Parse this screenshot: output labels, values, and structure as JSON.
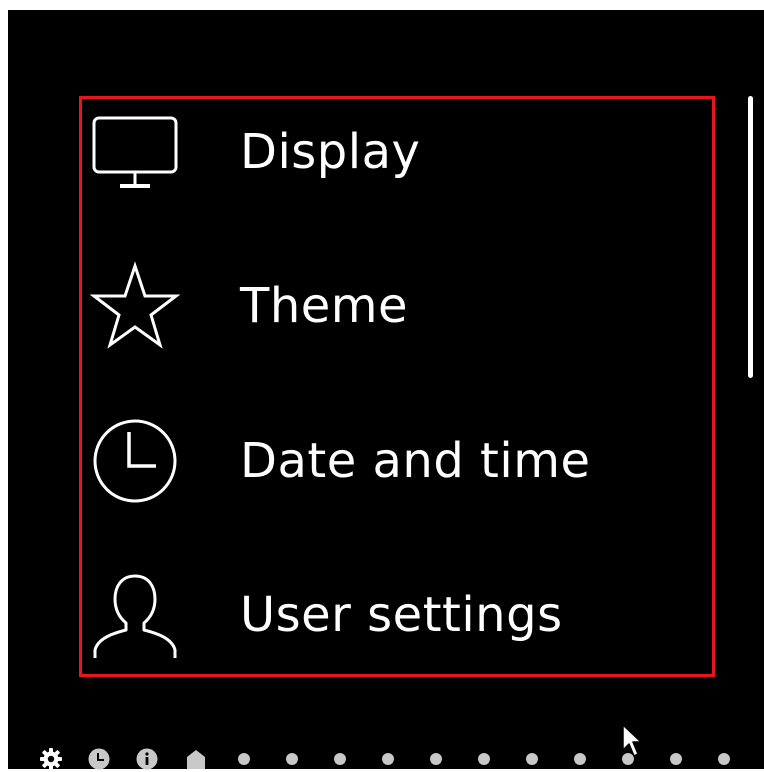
{
  "menu": {
    "items": [
      {
        "label": "Display",
        "icon": "monitor-icon"
      },
      {
        "label": "Theme",
        "icon": "star-icon"
      },
      {
        "label": "Date and time",
        "icon": "clock-icon"
      },
      {
        "label": "User settings",
        "icon": "user-icon"
      }
    ]
  },
  "page_indicator": {
    "icons": [
      "gear-icon",
      "clock-icon",
      "info-icon",
      "home-icon"
    ],
    "dot_count": 11
  },
  "colors": {
    "background": "#000000",
    "foreground": "#ffffff",
    "highlight": "#e8141e",
    "indicator": "#c8c8c8"
  }
}
